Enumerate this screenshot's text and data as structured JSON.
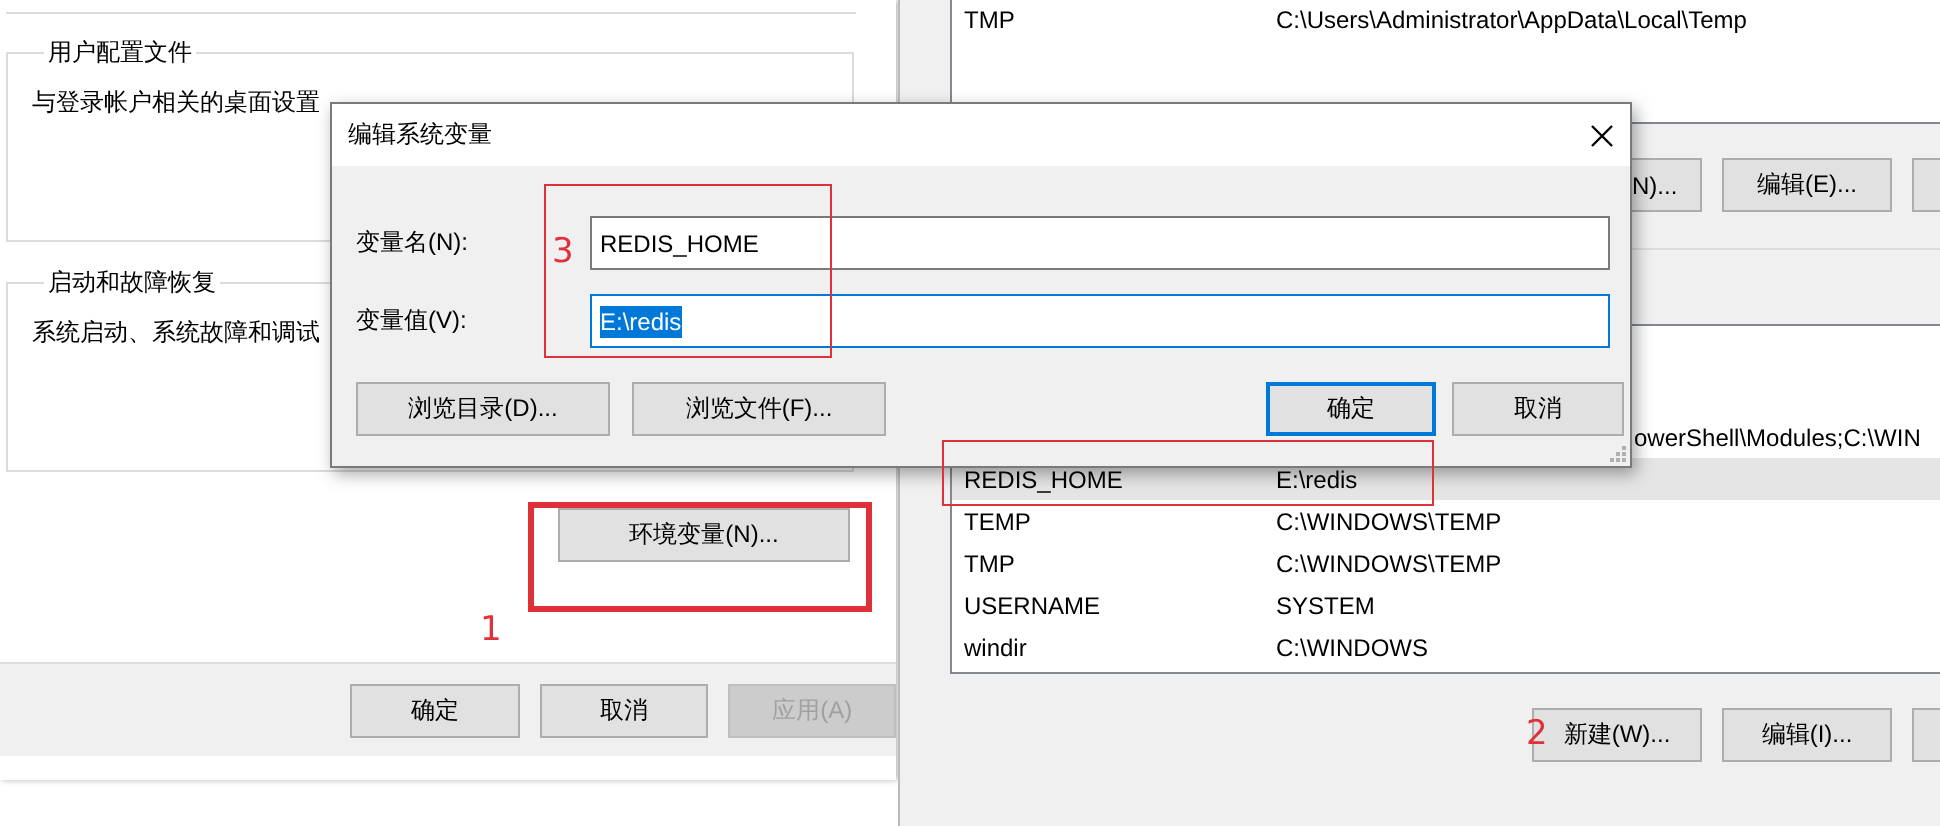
{
  "system_properties": {
    "user_profiles": {
      "title": "用户配置文件",
      "description": "与登录帐户相关的桌面设置"
    },
    "startup_recovery": {
      "title": "启动和故障恢复",
      "description": "系统启动、系统故障和调试"
    },
    "env_button": "环境变量(N)...",
    "buttons": [
      {
        "label": "确定",
        "disabled": false
      },
      {
        "label": "取消",
        "disabled": false
      },
      {
        "label": "应用(A)",
        "disabled": true
      }
    ]
  },
  "environment_variables": {
    "user_variables": [
      {
        "name": "TMP",
        "value": "C:\\Users\\Administrator\\AppData\\Local\\Temp",
        "selected": false
      }
    ],
    "user_buttons": [
      "N)...",
      "编辑(E)..."
    ],
    "system_variables": [
      {
        "value": "owerShell\\Modules;C:\\WIN",
        "selected": false
      },
      {
        "name": "REDIS_HOME",
        "value": "E:\\redis",
        "selected": true
      },
      {
        "name": "TEMP",
        "value": "C:\\WINDOWS\\TEMP",
        "selected": false
      },
      {
        "name": "TMP",
        "value": "C:\\WINDOWS\\TEMP",
        "selected": false
      },
      {
        "name": "USERNAME",
        "value": "SYSTEM",
        "selected": false
      },
      {
        "name": "windir",
        "value": "C:\\WINDOWS",
        "selected": false
      }
    ],
    "system_buttons": [
      "新建(W)...",
      "编辑(I)..."
    ]
  },
  "dialog": {
    "title": "编辑系统变量",
    "fields": [
      {
        "label": "变量名(N):",
        "value": "REDIS_HOME",
        "focused": false
      },
      {
        "label": "变量值(V):",
        "value": "E:\\redis",
        "focused": true
      }
    ],
    "browse_buttons": [
      "浏览目录(D)...",
      "浏览文件(F)..."
    ],
    "buttons": [
      {
        "label": "确定",
        "default": true
      },
      {
        "label": "取消",
        "default": false
      }
    ]
  },
  "annotations": [
    {
      "label": "1"
    },
    {
      "label": "2"
    },
    {
      "label": "3"
    }
  ]
}
